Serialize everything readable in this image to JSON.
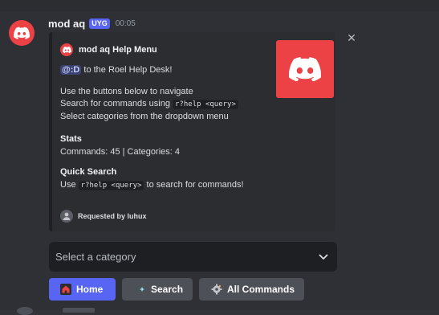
{
  "message": {
    "username": "mod aq",
    "tag": "UYG",
    "timestamp": "00:05"
  },
  "embed": {
    "author": "mod aq Help Menu",
    "mention": "@:D",
    "greeting_rest": " to the Roel Help Desk!",
    "line_navigate": "Use the buttons below to navigate",
    "line_search_prefix": "Search for commands using ",
    "search_code": "r?help <query>",
    "line_categories": "Select categories from the dropdown menu",
    "stats_title": "Stats",
    "stats_value": "Commands: 45 | Categories: 4",
    "quick_title": "Quick Search",
    "quick_prefix": "Use ",
    "quick_code": "r?help <query>",
    "quick_suffix": " to search for commands!",
    "footer": "Requested by luhux"
  },
  "select": {
    "placeholder": "Select a category"
  },
  "buttons": {
    "home": "Home",
    "search": "Search",
    "all_commands": "All Commands"
  },
  "colors": {
    "brand_red": "#ed4245",
    "blurple": "#5865f2",
    "secondary_button": "#4e5058"
  },
  "icons": {
    "avatar": "discord-logo-icon",
    "close": "close-icon",
    "select": "chevron-down-icon",
    "home": "home-icon",
    "search": "sparkle-icon",
    "all_commands": "gear-icon"
  }
}
